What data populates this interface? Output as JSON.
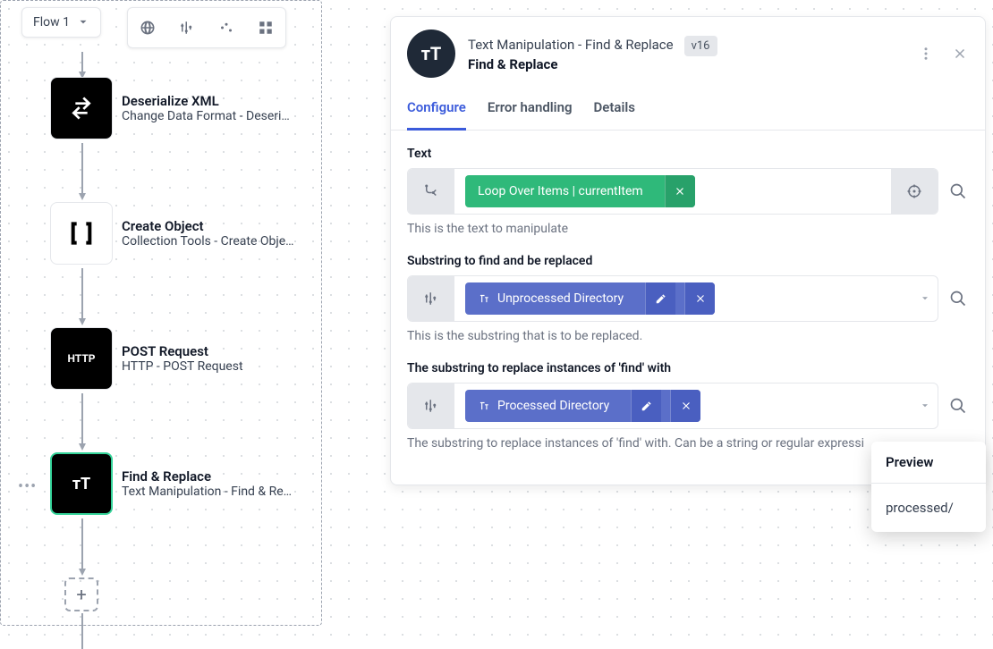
{
  "flowSelector": {
    "label": "Flow 1"
  },
  "nodes": {
    "deserialize": {
      "title": "Deserialize XML",
      "subtitle": "Change Data Format - Deseri…"
    },
    "createObject": {
      "title": "Create Object",
      "subtitle": "Collection Tools - Create Obje…"
    },
    "postRequest": {
      "title": "POST Request",
      "subtitle": "HTTP - POST Request"
    },
    "findReplace": {
      "title": "Find & Replace",
      "subtitle": "Text Manipulation - Find & Re…"
    }
  },
  "panel": {
    "category": "Text Manipulation - Find & Replace",
    "name": "Find & Replace",
    "version": "v16",
    "tabs": {
      "configure": "Configure",
      "errorHandling": "Error handling",
      "details": "Details"
    },
    "fields": {
      "text": {
        "label": "Text",
        "pill": "Loop Over Items | currentItem",
        "help": "This is the text to manipulate"
      },
      "find": {
        "label": "Substring to find and be replaced",
        "pill": "Unprocessed Directory",
        "help": "This is the substring that is to be replaced."
      },
      "replace": {
        "label": "The substring to replace instances of 'find' with",
        "pill": "Processed Directory",
        "help": "The substring to replace instances of 'find' with. Can be a string or regular expressi"
      }
    }
  },
  "preview": {
    "title": "Preview",
    "value": "processed/"
  }
}
